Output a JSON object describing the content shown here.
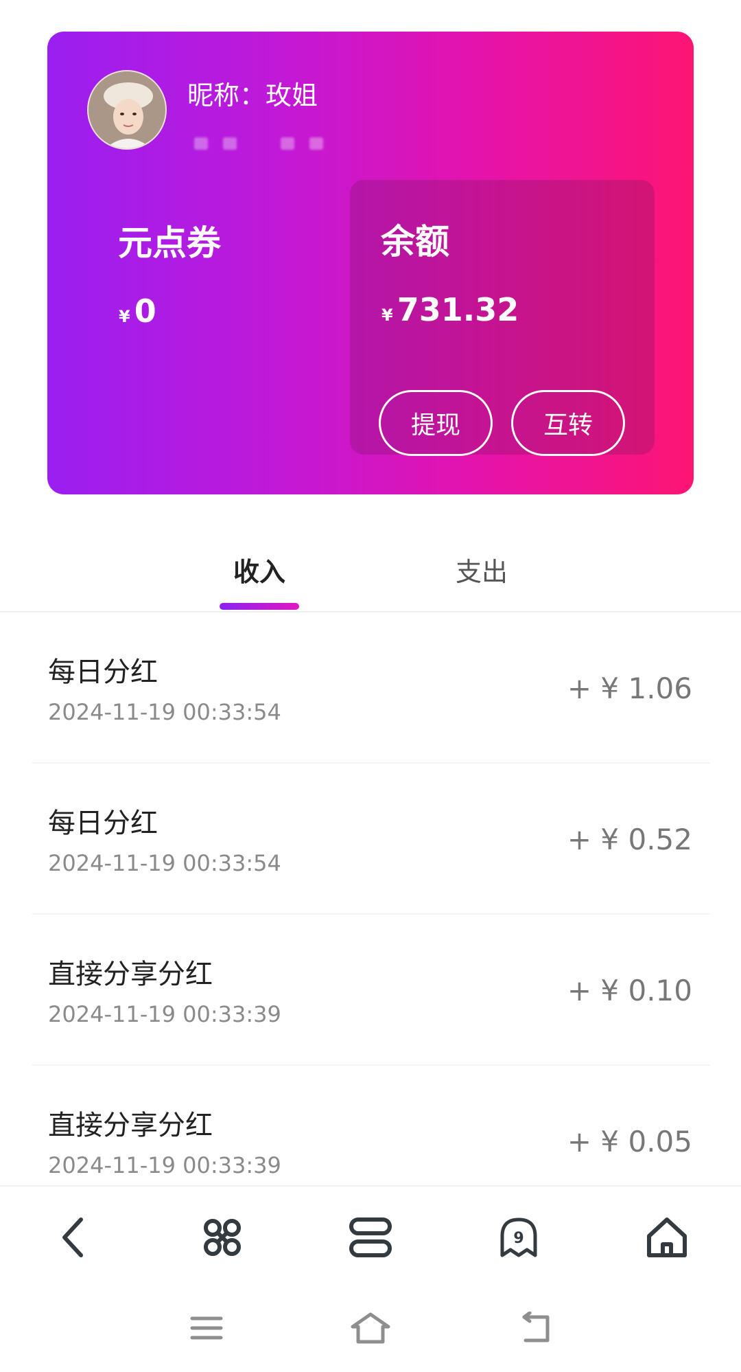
{
  "profile": {
    "nickname": "昵称：玫姐"
  },
  "wallet": {
    "coupon_label": "元点券",
    "coupon_currency": "¥",
    "coupon_value": "0",
    "balance_label": "余额",
    "balance_currency": "¥",
    "balance_value": "731.32",
    "withdraw_label": "提现",
    "transfer_label": "互转"
  },
  "tabs": [
    {
      "label": "收入",
      "active": true
    },
    {
      "label": "支出",
      "active": false
    }
  ],
  "records": [
    {
      "title": "每日分红",
      "time": "2024-11-19 00:33:54",
      "amount": "+ ¥ 1.06"
    },
    {
      "title": "每日分红",
      "time": "2024-11-19 00:33:54",
      "amount": "+ ¥ 0.52"
    },
    {
      "title": "直接分享分红",
      "time": "2024-11-19 00:33:39",
      "amount": "+ ¥ 0.10"
    },
    {
      "title": "直接分享分红",
      "time": "2024-11-19 00:33:39",
      "amount": "+ ¥ 0.05"
    }
  ],
  "bottom_nav": [
    {
      "icon": "back-arrow-icon"
    },
    {
      "icon": "command-icon"
    },
    {
      "icon": "tabs-icon"
    },
    {
      "icon": "ghost-badge-icon",
      "badge": "9"
    },
    {
      "icon": "home-icon"
    }
  ],
  "system_bar": [
    {
      "icon": "menu-icon"
    },
    {
      "icon": "home-outline-icon"
    },
    {
      "icon": "return-icon"
    }
  ],
  "colors": {
    "gradient_start": "#9a1ff0",
    "gradient_end": "#fd1574",
    "tab_indicator": "#8a22f0"
  }
}
